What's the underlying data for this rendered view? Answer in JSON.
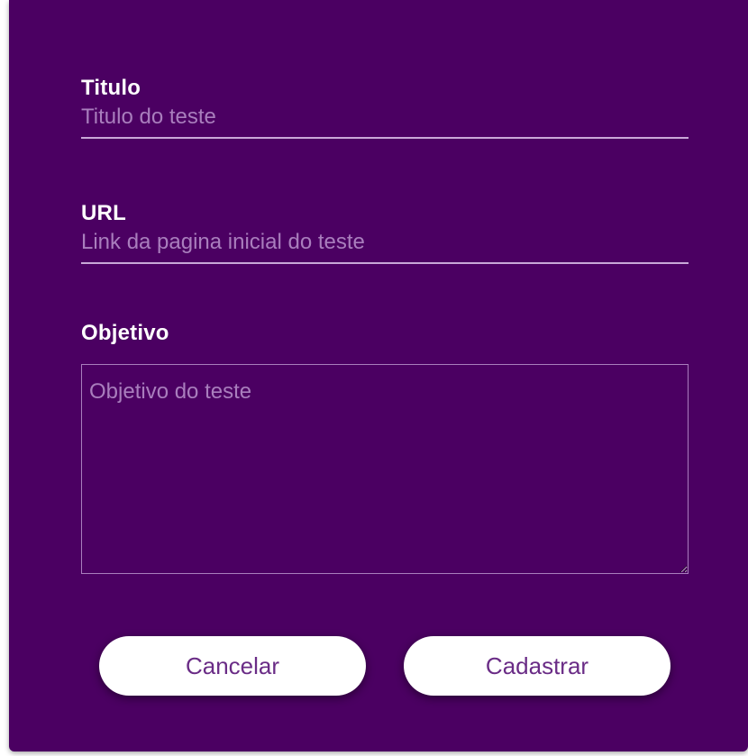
{
  "form": {
    "titulo": {
      "label": "Titulo",
      "placeholder": "Titulo do teste",
      "value": ""
    },
    "url": {
      "label": "URL",
      "placeholder": "Link da pagina inicial do teste",
      "value": ""
    },
    "objetivo": {
      "label": "Objetivo",
      "placeholder": "Objetivo do teste",
      "value": ""
    }
  },
  "actions": {
    "cancel_label": "Cancelar",
    "submit_label": "Cadastrar"
  },
  "colors": {
    "dialog_background": "#4b0062",
    "button_background": "#ffffff",
    "button_text": "#6a2c86",
    "placeholder": "#a97ebd"
  }
}
